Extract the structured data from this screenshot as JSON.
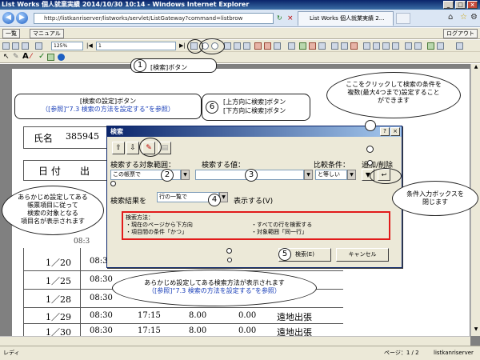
{
  "window": {
    "title": "List Works 個人就業実績 2014/10/30 10:14 - Windows Internet Explorer",
    "url": "http://listkanriserver/listworks/servlet/ListGateway?command=listbrow",
    "tab_label": "List Works 個人就業実績 2...",
    "minimize": "_",
    "maximize": "□",
    "close": "×"
  },
  "app_menu": {
    "list_button": "一覧",
    "manual_button": "マニュアル",
    "logout_button": "ログアウト"
  },
  "toolbar": {
    "zoom": "125%",
    "page": "1"
  },
  "report": {
    "title_char": "人",
    "name_label": "氏名",
    "employee_no": "385945",
    "header_date": "日 付",
    "header_out": "出",
    "rows": [
      {
        "date": "1／20",
        "time_in": "08:3"
      },
      {
        "date": "1／25",
        "time_in": "08:30"
      },
      {
        "date": "1／28",
        "time_in": "08:30"
      },
      {
        "date": "1／29",
        "time_in": "08:30",
        "time_out": "17:15",
        "hours": "8.00",
        "ot": "0.00",
        "note": "遠地出張"
      },
      {
        "date": "1／30",
        "time_in": "08:30",
        "time_out": "17:15",
        "hours": "8.00",
        "ot": "0.00",
        "note": "遠地出張"
      }
    ],
    "partial_hidden_time": "08:3"
  },
  "dialog": {
    "title": "検索",
    "help_btn": "?",
    "close_btn": "×",
    "col_range": "検索する対象範囲：",
    "col_value": "検索する値：",
    "col_compare": "比較条件：",
    "col_add": "追加/削除",
    "range_value": "この帳票で",
    "search_value": "",
    "compare_value": "と等しい",
    "result_label": "検索結果を",
    "result_value": "行の一覧で",
    "result_suffix": "表示する(V)",
    "method_title": "検索方法：",
    "method_l1": "・現在のページから下方向",
    "method_l2": "・項目間の条件「かつ」",
    "method_r1": "・すべての行を検索する",
    "method_r2": "・対象範囲「同一行」",
    "search_button": "検索(E)",
    "cancel_button": "キャンセル"
  },
  "callouts": {
    "num1": "1",
    "num1_text": "[検索]ボタン",
    "num2": "2",
    "num3": "3",
    "num4": "4",
    "num5": "5",
    "num6": "6",
    "settings_l1": "[検索の設定]ボタン",
    "settings_l2": "（[参照]“7.3 検索の方法を設定する”を参照）",
    "updown_l1": "[上方向に検索]ボタン",
    "updown_l2": "[下方向に検索]ボタン",
    "multi_l1": "ここをクリックして検索の条件を",
    "multi_l2": "複数(最大4つまで)設定すること",
    "multi_l3": "ができます",
    "items_l1": "あらかじめ設定してある",
    "items_l2": "帳票項目に従って",
    "items_l3": "検索の対象となる",
    "items_l4": "項目名が表示されます",
    "close_l1": "条件入力ボックスを",
    "close_l2": "閉じます",
    "method_l1": "あらかじめ設定してある検索方法が表示されます",
    "method_l2": "（[参照]“7.3 検索の方法を設定する”を参照）"
  },
  "status": {
    "left": "レディ",
    "page": "ページ：1 / 2",
    "server": "listkanriserver"
  }
}
